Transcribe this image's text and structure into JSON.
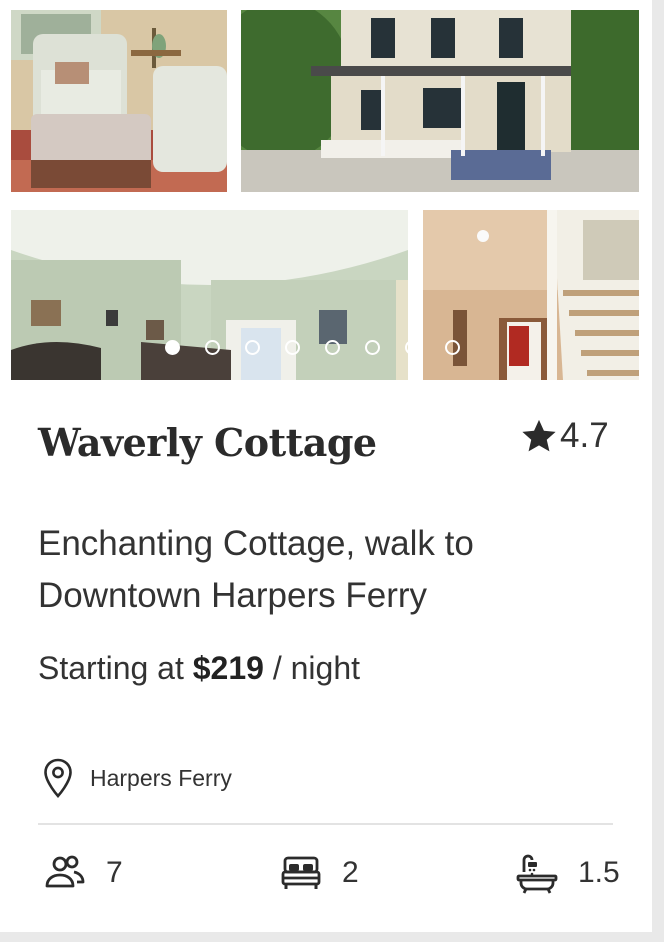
{
  "listing": {
    "title": "Waverly Cottage",
    "rating": "4.7",
    "description": "Enchanting Cottage, walk to Downtown Harpers Ferry",
    "price_prefix": "Starting at ",
    "price": "$219",
    "price_suffix": " / night",
    "location": "Harpers Ferry"
  },
  "gallery": {
    "photo_count": 4,
    "dot_count": 8,
    "active_dot": 1
  },
  "amenities": {
    "guests": "7",
    "bedrooms": "2",
    "bathrooms": "1.5"
  },
  "icons": {
    "rating": "star-icon",
    "location": "map-pin-icon",
    "guests": "people-icon",
    "bedrooms": "bed-icon",
    "bathrooms": "bathtub-icon"
  },
  "colors": {
    "text": "#333333",
    "title": "#2b2b2b",
    "star": "#2b2b2b",
    "divider": "#e3e3e3",
    "card_bg": "#ffffff"
  }
}
